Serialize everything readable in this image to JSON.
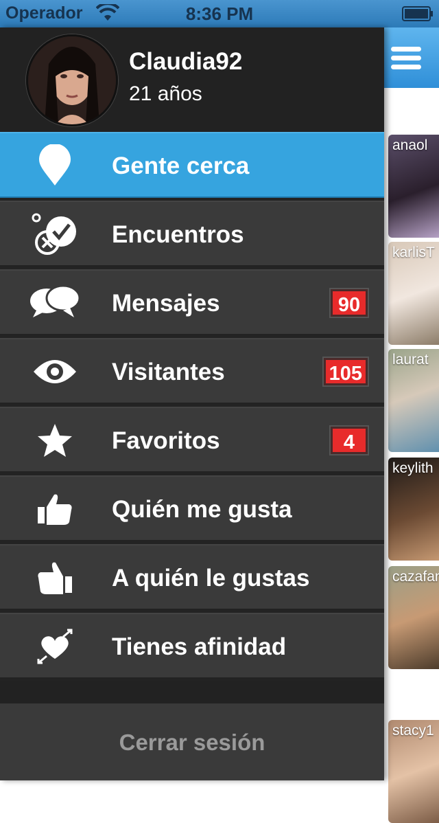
{
  "status_bar": {
    "carrier": "Operador",
    "time": "8:36 PM"
  },
  "profile": {
    "username": "Claudia92",
    "age": "21 años"
  },
  "menu": {
    "items": [
      {
        "label": "Gente cerca",
        "icon": "location-pin-icon",
        "badge": null
      },
      {
        "label": "Encuentros",
        "icon": "match-check-icon",
        "badge": null
      },
      {
        "label": "Mensajes",
        "icon": "chat-bubbles-icon",
        "badge": "90"
      },
      {
        "label": "Visitantes",
        "icon": "eye-icon",
        "badge": "105"
      },
      {
        "label": "Favoritos",
        "icon": "star-icon",
        "badge": "4"
      },
      {
        "label": "Quién me gusta",
        "icon": "thumbs-up-left-icon",
        "badge": null
      },
      {
        "label": "A quién le gustas",
        "icon": "thumbs-up-right-icon",
        "badge": null
      },
      {
        "label": "Tienes afinidad",
        "icon": "heart-affinity-icon",
        "badge": null
      }
    ],
    "logout": "Cerrar sesión"
  },
  "people": [
    {
      "name": "anaol"
    },
    {
      "name": "karlisT"
    },
    {
      "name": "laurat"
    },
    {
      "name": "keylith"
    },
    {
      "name": "cazafan"
    },
    {
      "name": "stacy1"
    }
  ],
  "colors": {
    "accent": "#36a4df",
    "badge": "#e82b2b",
    "menu_bg": "#3a3a3a"
  }
}
